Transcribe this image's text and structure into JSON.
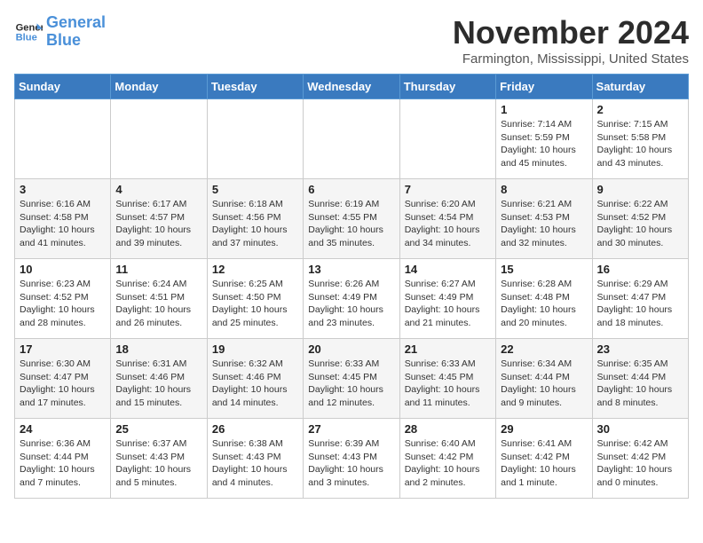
{
  "header": {
    "logo_line1": "General",
    "logo_line2": "Blue",
    "month": "November 2024",
    "location": "Farmington, Mississippi, United States"
  },
  "weekdays": [
    "Sunday",
    "Monday",
    "Tuesday",
    "Wednesday",
    "Thursday",
    "Friday",
    "Saturday"
  ],
  "weeks": [
    [
      {
        "day": "",
        "info": ""
      },
      {
        "day": "",
        "info": ""
      },
      {
        "day": "",
        "info": ""
      },
      {
        "day": "",
        "info": ""
      },
      {
        "day": "",
        "info": ""
      },
      {
        "day": "1",
        "info": "Sunrise: 7:14 AM\nSunset: 5:59 PM\nDaylight: 10 hours\nand 45 minutes."
      },
      {
        "day": "2",
        "info": "Sunrise: 7:15 AM\nSunset: 5:58 PM\nDaylight: 10 hours\nand 43 minutes."
      }
    ],
    [
      {
        "day": "3",
        "info": "Sunrise: 6:16 AM\nSunset: 4:58 PM\nDaylight: 10 hours\nand 41 minutes."
      },
      {
        "day": "4",
        "info": "Sunrise: 6:17 AM\nSunset: 4:57 PM\nDaylight: 10 hours\nand 39 minutes."
      },
      {
        "day": "5",
        "info": "Sunrise: 6:18 AM\nSunset: 4:56 PM\nDaylight: 10 hours\nand 37 minutes."
      },
      {
        "day": "6",
        "info": "Sunrise: 6:19 AM\nSunset: 4:55 PM\nDaylight: 10 hours\nand 35 minutes."
      },
      {
        "day": "7",
        "info": "Sunrise: 6:20 AM\nSunset: 4:54 PM\nDaylight: 10 hours\nand 34 minutes."
      },
      {
        "day": "8",
        "info": "Sunrise: 6:21 AM\nSunset: 4:53 PM\nDaylight: 10 hours\nand 32 minutes."
      },
      {
        "day": "9",
        "info": "Sunrise: 6:22 AM\nSunset: 4:52 PM\nDaylight: 10 hours\nand 30 minutes."
      }
    ],
    [
      {
        "day": "10",
        "info": "Sunrise: 6:23 AM\nSunset: 4:52 PM\nDaylight: 10 hours\nand 28 minutes."
      },
      {
        "day": "11",
        "info": "Sunrise: 6:24 AM\nSunset: 4:51 PM\nDaylight: 10 hours\nand 26 minutes."
      },
      {
        "day": "12",
        "info": "Sunrise: 6:25 AM\nSunset: 4:50 PM\nDaylight: 10 hours\nand 25 minutes."
      },
      {
        "day": "13",
        "info": "Sunrise: 6:26 AM\nSunset: 4:49 PM\nDaylight: 10 hours\nand 23 minutes."
      },
      {
        "day": "14",
        "info": "Sunrise: 6:27 AM\nSunset: 4:49 PM\nDaylight: 10 hours\nand 21 minutes."
      },
      {
        "day": "15",
        "info": "Sunrise: 6:28 AM\nSunset: 4:48 PM\nDaylight: 10 hours\nand 20 minutes."
      },
      {
        "day": "16",
        "info": "Sunrise: 6:29 AM\nSunset: 4:47 PM\nDaylight: 10 hours\nand 18 minutes."
      }
    ],
    [
      {
        "day": "17",
        "info": "Sunrise: 6:30 AM\nSunset: 4:47 PM\nDaylight: 10 hours\nand 17 minutes."
      },
      {
        "day": "18",
        "info": "Sunrise: 6:31 AM\nSunset: 4:46 PM\nDaylight: 10 hours\nand 15 minutes."
      },
      {
        "day": "19",
        "info": "Sunrise: 6:32 AM\nSunset: 4:46 PM\nDaylight: 10 hours\nand 14 minutes."
      },
      {
        "day": "20",
        "info": "Sunrise: 6:33 AM\nSunset: 4:45 PM\nDaylight: 10 hours\nand 12 minutes."
      },
      {
        "day": "21",
        "info": "Sunrise: 6:33 AM\nSunset: 4:45 PM\nDaylight: 10 hours\nand 11 minutes."
      },
      {
        "day": "22",
        "info": "Sunrise: 6:34 AM\nSunset: 4:44 PM\nDaylight: 10 hours\nand 9 minutes."
      },
      {
        "day": "23",
        "info": "Sunrise: 6:35 AM\nSunset: 4:44 PM\nDaylight: 10 hours\nand 8 minutes."
      }
    ],
    [
      {
        "day": "24",
        "info": "Sunrise: 6:36 AM\nSunset: 4:44 PM\nDaylight: 10 hours\nand 7 minutes."
      },
      {
        "day": "25",
        "info": "Sunrise: 6:37 AM\nSunset: 4:43 PM\nDaylight: 10 hours\nand 5 minutes."
      },
      {
        "day": "26",
        "info": "Sunrise: 6:38 AM\nSunset: 4:43 PM\nDaylight: 10 hours\nand 4 minutes."
      },
      {
        "day": "27",
        "info": "Sunrise: 6:39 AM\nSunset: 4:43 PM\nDaylight: 10 hours\nand 3 minutes."
      },
      {
        "day": "28",
        "info": "Sunrise: 6:40 AM\nSunset: 4:42 PM\nDaylight: 10 hours\nand 2 minutes."
      },
      {
        "day": "29",
        "info": "Sunrise: 6:41 AM\nSunset: 4:42 PM\nDaylight: 10 hours\nand 1 minute."
      },
      {
        "day": "30",
        "info": "Sunrise: 6:42 AM\nSunset: 4:42 PM\nDaylight: 10 hours\nand 0 minutes."
      }
    ]
  ]
}
